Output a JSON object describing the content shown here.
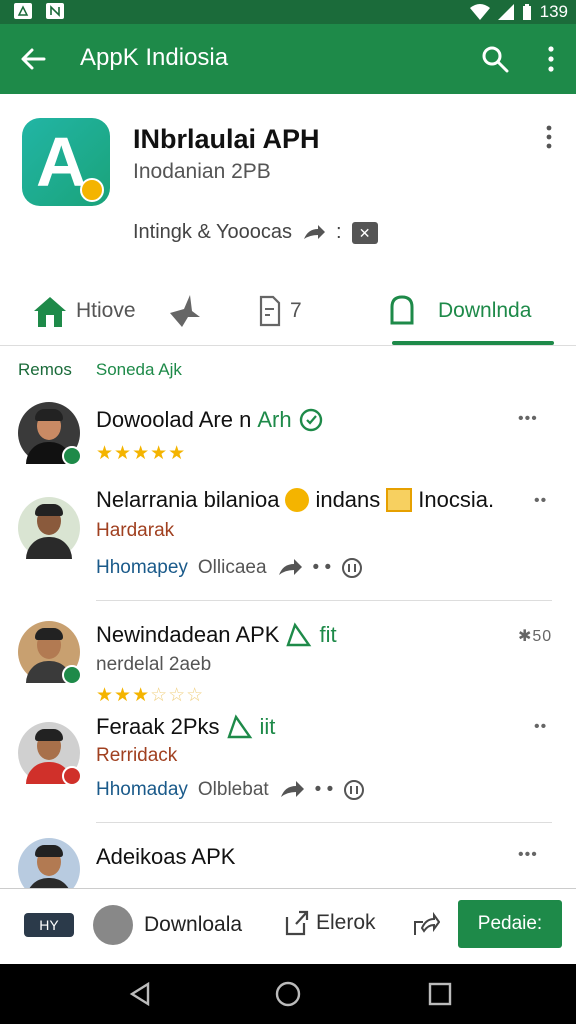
{
  "status_bar": {
    "time": "139"
  },
  "app_bar": {
    "title": "AppK Indiosia"
  },
  "app_header": {
    "name": "INbrlaulai APH",
    "subtitle": "Inodanian 2PB",
    "meta": "Intingk & Yooocas",
    "meta_box": "✕"
  },
  "tabs": [
    {
      "label": "Htiove",
      "icon": "home-icon"
    },
    {
      "label": "",
      "icon": "bird-icon"
    },
    {
      "label": "7",
      "icon": "document-icon"
    },
    {
      "label": "Downlnda",
      "icon": "bell-icon",
      "active": true
    }
  ],
  "section": {
    "label_a": "Remos",
    "label_b": "Soneda Ajk"
  },
  "items": [
    {
      "title": "Dowoolad Are n",
      "title_green": "Arh",
      "stars": 5,
      "menu": "•••"
    },
    {
      "title": "Nelarrania bilanioa",
      "title_after": "indans",
      "title_end": "Inocsia.",
      "link": "Hardarak",
      "meta_label": "Hhomapey",
      "meta_value": "Ollicaea",
      "menu": "••"
    },
    {
      "title": "Newindadean APK",
      "title_green": "fit",
      "subtitle": "nerdelal 2aeb",
      "stars": 3,
      "menu": "✱50"
    },
    {
      "title": "Feraak 2Pks",
      "title_green": "iit",
      "link": "Rerridack",
      "meta_label": "Hhomaday",
      "meta_value": "Olblebat",
      "menu": "••"
    },
    {
      "title": "Adeikoas APK",
      "menu": "•••"
    }
  ],
  "action_bar": {
    "badge": "HY",
    "download": "Downloala",
    "break": "Elerok",
    "button": "Pedaie:"
  },
  "colors": {
    "primary": "#1e8a49",
    "status_bar": "#1b6b3a",
    "star": "#f4b400"
  }
}
